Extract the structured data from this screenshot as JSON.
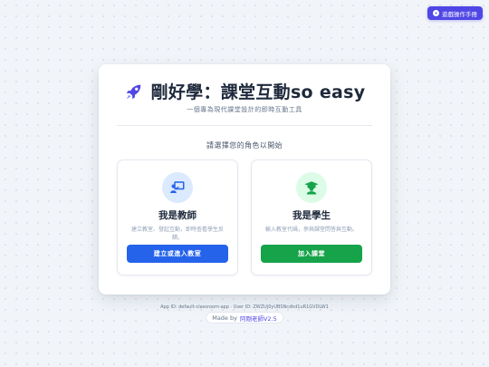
{
  "guide": {
    "label": "遊戲操作手冊",
    "icon": "play-circle-icon"
  },
  "header": {
    "title": "剛好學：課堂互動so easy",
    "subtitle": "一個專為現代課堂設計的即時互動工具",
    "icon": "rocket-icon"
  },
  "prompt": "請選擇您的角色以開始",
  "roles": {
    "teacher": {
      "title": "我是教師",
      "description": "建立教室、發起互動，即時查看學生反饋。",
      "button": "建立或進入教室",
      "icon": "teacher-board-icon"
    },
    "student": {
      "title": "我是學生",
      "description": "輸入教室代碼，參與課堂問答與互動。",
      "button": "加入課堂",
      "icon": "student-graduate-icon"
    }
  },
  "footer": {
    "ids": "App ID: default-classroom-app · User ID: ZWZUj0yUBSNcdkd1uR1GVDLW1",
    "made_by_prefix": "Made by",
    "made_by_author": "阿剛老師V2.5"
  },
  "colors": {
    "accent": "#4f46e5",
    "teacher": "#2563eb",
    "student": "#16a34a"
  }
}
